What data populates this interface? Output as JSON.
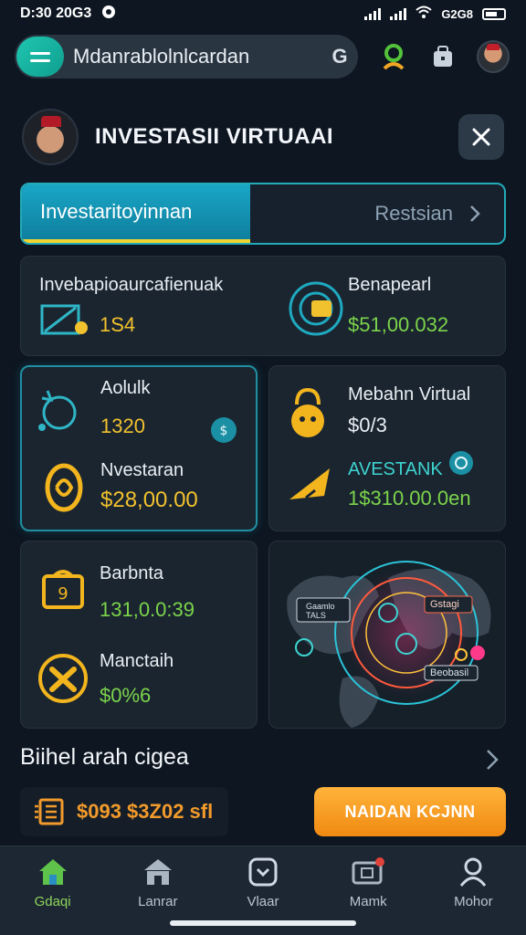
{
  "status_bar": {
    "time": "D:30 20G3",
    "battery_text": "G2G8"
  },
  "top_bar": {
    "search_text": "Mdanrablolnlcardan",
    "icons": [
      "menu-icon",
      "g-icon",
      "location-pin-icon",
      "wallet-icon",
      "avatar"
    ]
  },
  "header": {
    "title": "INVESTASII VIRTUAAI"
  },
  "tabs": {
    "active": "Investaritoyinnan",
    "inactive": "Restsian"
  },
  "cards": {
    "top_left": {
      "label": "Invebapioaurcafienuak",
      "value": "1S4"
    },
    "top_right": {
      "label": "Benapearl",
      "value": "$51,00.032"
    },
    "mid_left": {
      "item1": {
        "label": "Aolulk",
        "value": "1320"
      },
      "item2": {
        "label": "Nvestaran",
        "value": "$28,00.00"
      }
    },
    "mid_right": {
      "item1": {
        "label": "Mebahn Virtual",
        "value": "$0/3"
      },
      "item2": {
        "label": "AVESTANK",
        "value": "1$310.00.0en"
      }
    },
    "low_left": {
      "item1": {
        "label": "Barbnta",
        "value": "131,0.0:39"
      },
      "item2": {
        "label": "Manctaih",
        "value": "$0%6"
      }
    },
    "map_card": {
      "tag1": "Gaamlo\nTALS",
      "tag2": "Gstagi",
      "tag3": "Beobasil"
    }
  },
  "section": {
    "title": "Biihel arah cigea",
    "balance": "$093 $3Z02 sfl",
    "cta": "NAIDAN KCJNN"
  },
  "bottom_nav": {
    "items": [
      {
        "label": "Gdaqi",
        "icon": "home-icon",
        "active": true
      },
      {
        "label": "Lanrar",
        "icon": "bank-icon",
        "active": false
      },
      {
        "label": "Vlaar",
        "icon": "chevron-box-icon",
        "active": false
      },
      {
        "label": "Mamk",
        "icon": "screen-icon",
        "active": false
      },
      {
        "label": "Mohor",
        "icon": "user-icon",
        "active": false
      }
    ]
  },
  "colors": {
    "accent_cyan": "#1aa6c6",
    "accent_yellow": "#f2c12e",
    "accent_green": "#7cd44b",
    "accent_orange": "#f08a12",
    "bg": "#0d1621"
  }
}
